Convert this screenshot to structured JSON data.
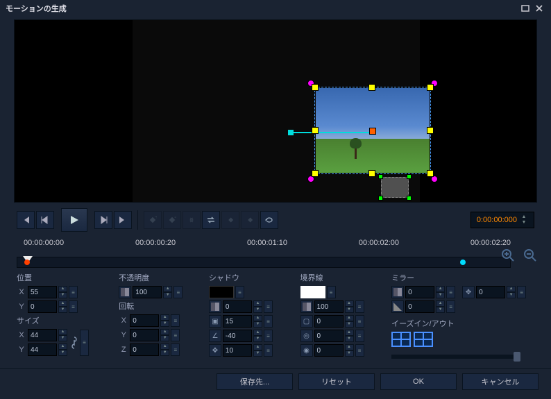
{
  "title": "モーションの生成",
  "timecode": "0:00:00:000",
  "timeline_labels": [
    "00:00:00:00",
    "00:00:00:20",
    "00:00:01:10",
    "00:00:02:00",
    "00:00:02:20"
  ],
  "position": {
    "label": "位置",
    "x_label": "X",
    "x": "55",
    "y_label": "Y",
    "y": "0"
  },
  "size": {
    "label": "サイズ",
    "x_label": "X",
    "x": "44",
    "y_label": "Y",
    "y": "44"
  },
  "opacity": {
    "label": "不透明度",
    "value": "100"
  },
  "rotation": {
    "label": "回転",
    "x_label": "X",
    "x": "0",
    "y_label": "Y",
    "y": "0",
    "z_label": "Z",
    "z": "0"
  },
  "shadow": {
    "label": "シャドウ",
    "opacity": "0",
    "distance": "15",
    "angle": "-40",
    "spread": "10"
  },
  "border": {
    "label": "境界線",
    "opacity": "100",
    "width": "0",
    "soft": "0",
    "round": "0"
  },
  "mirror": {
    "label": "ミラー",
    "v1": "0",
    "v2": "0",
    "move": "0"
  },
  "ease": {
    "label": "イーズイン/アウト"
  },
  "buttons": {
    "save": "保存先...",
    "reset": "リセット",
    "ok": "OK",
    "cancel": "キャンセル"
  }
}
